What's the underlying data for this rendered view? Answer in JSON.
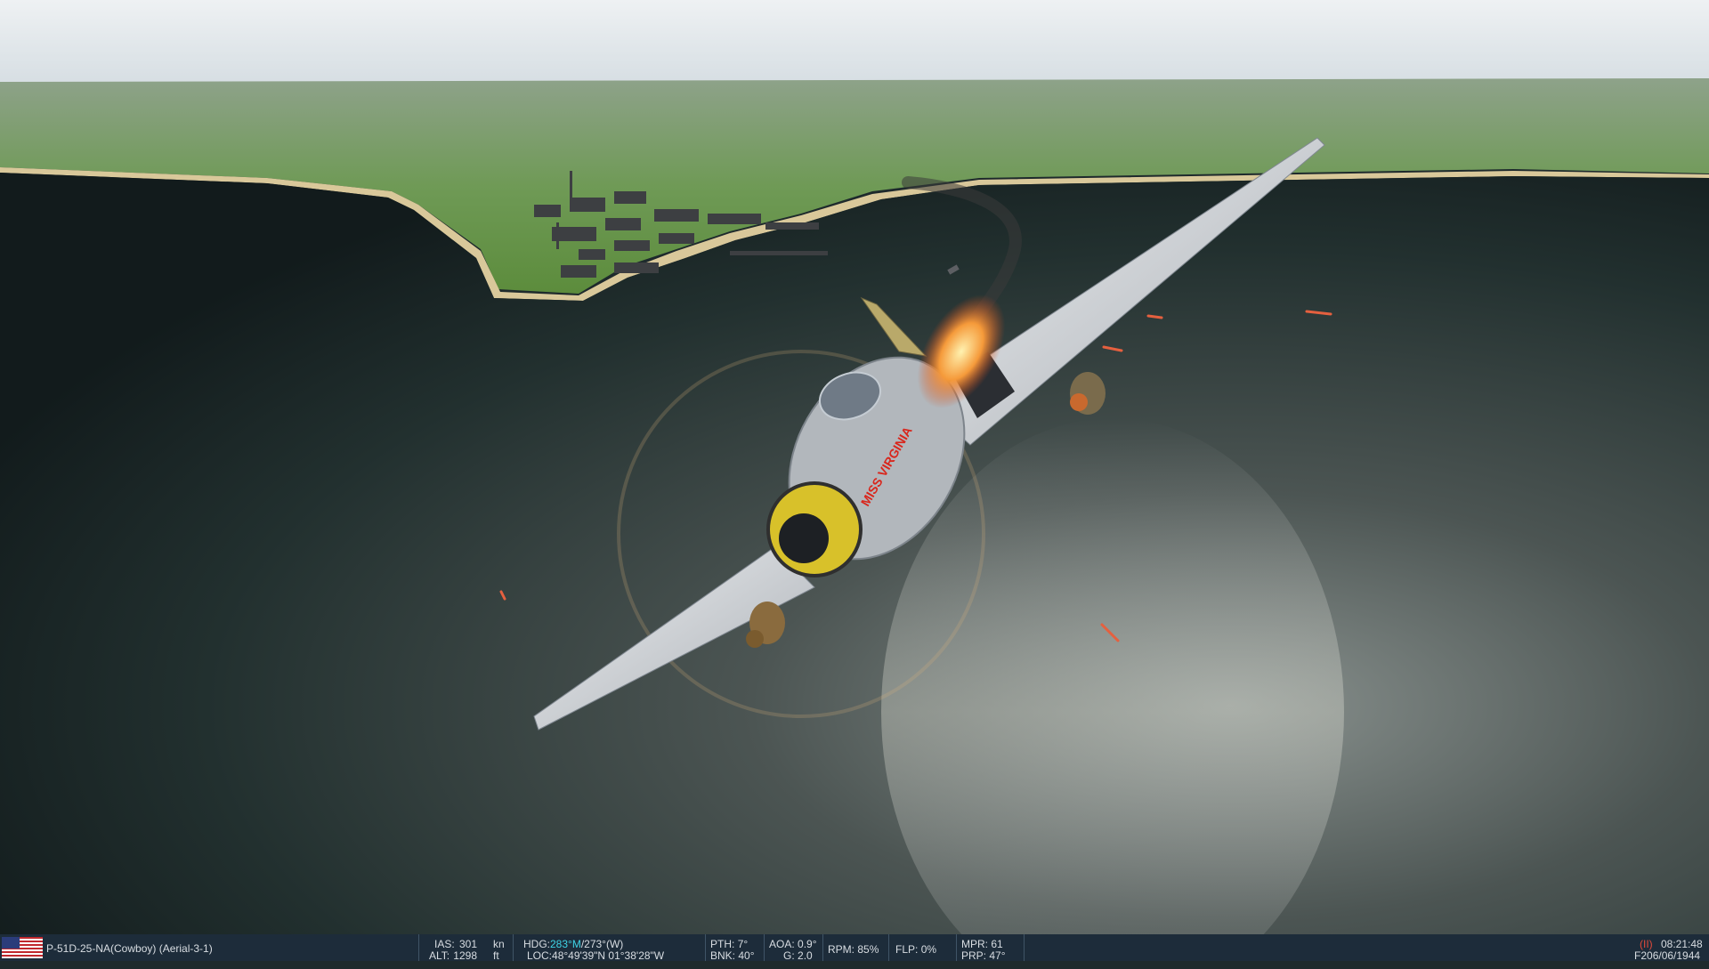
{
  "aircraft": {
    "country_flag": "usa-flag-icon",
    "name": "P-51D-25-NA(Cowboy) (Aerial-3-1)",
    "nose_art": "MISS VIRGINIA"
  },
  "hud": {
    "ias_label": "IAS:",
    "ias_value": "301",
    "ias_unit": "kn",
    "alt_label": "ALT:",
    "alt_value": "1298",
    "alt_unit": "ft",
    "hdg_label": "HDG:",
    "hdg_magnetic": "283°M",
    "hdg_true": "/273°(W)",
    "loc_label": "LOC:",
    "loc_value": "48°49'39\"N 01°38'28\"W",
    "pth_label": "PTH:",
    "pth_value": "7°",
    "bnk_label": "BNK:",
    "bnk_value": "40°",
    "aoa_label": "AOA:",
    "aoa_value": "0.9°",
    "g_label": "G:",
    "g_value": "2.0",
    "rpm_label": "RPM:",
    "rpm_value": "85%",
    "flp_label": "FLP:",
    "flp_value": "0%",
    "mpr_label": "MPR:",
    "mpr_value": "61",
    "prp_label": "PRP:",
    "prp_value": "47°",
    "pause_indicator": "(II)",
    "time": "08:21:48",
    "view_key": "F2",
    "date": "06/06/1944"
  },
  "colors": {
    "hud_bg": "#1d2c3a",
    "hud_text": "#d8dde2",
    "heading_accent": "#3fd4e6",
    "pause_red": "#e04a3a"
  }
}
